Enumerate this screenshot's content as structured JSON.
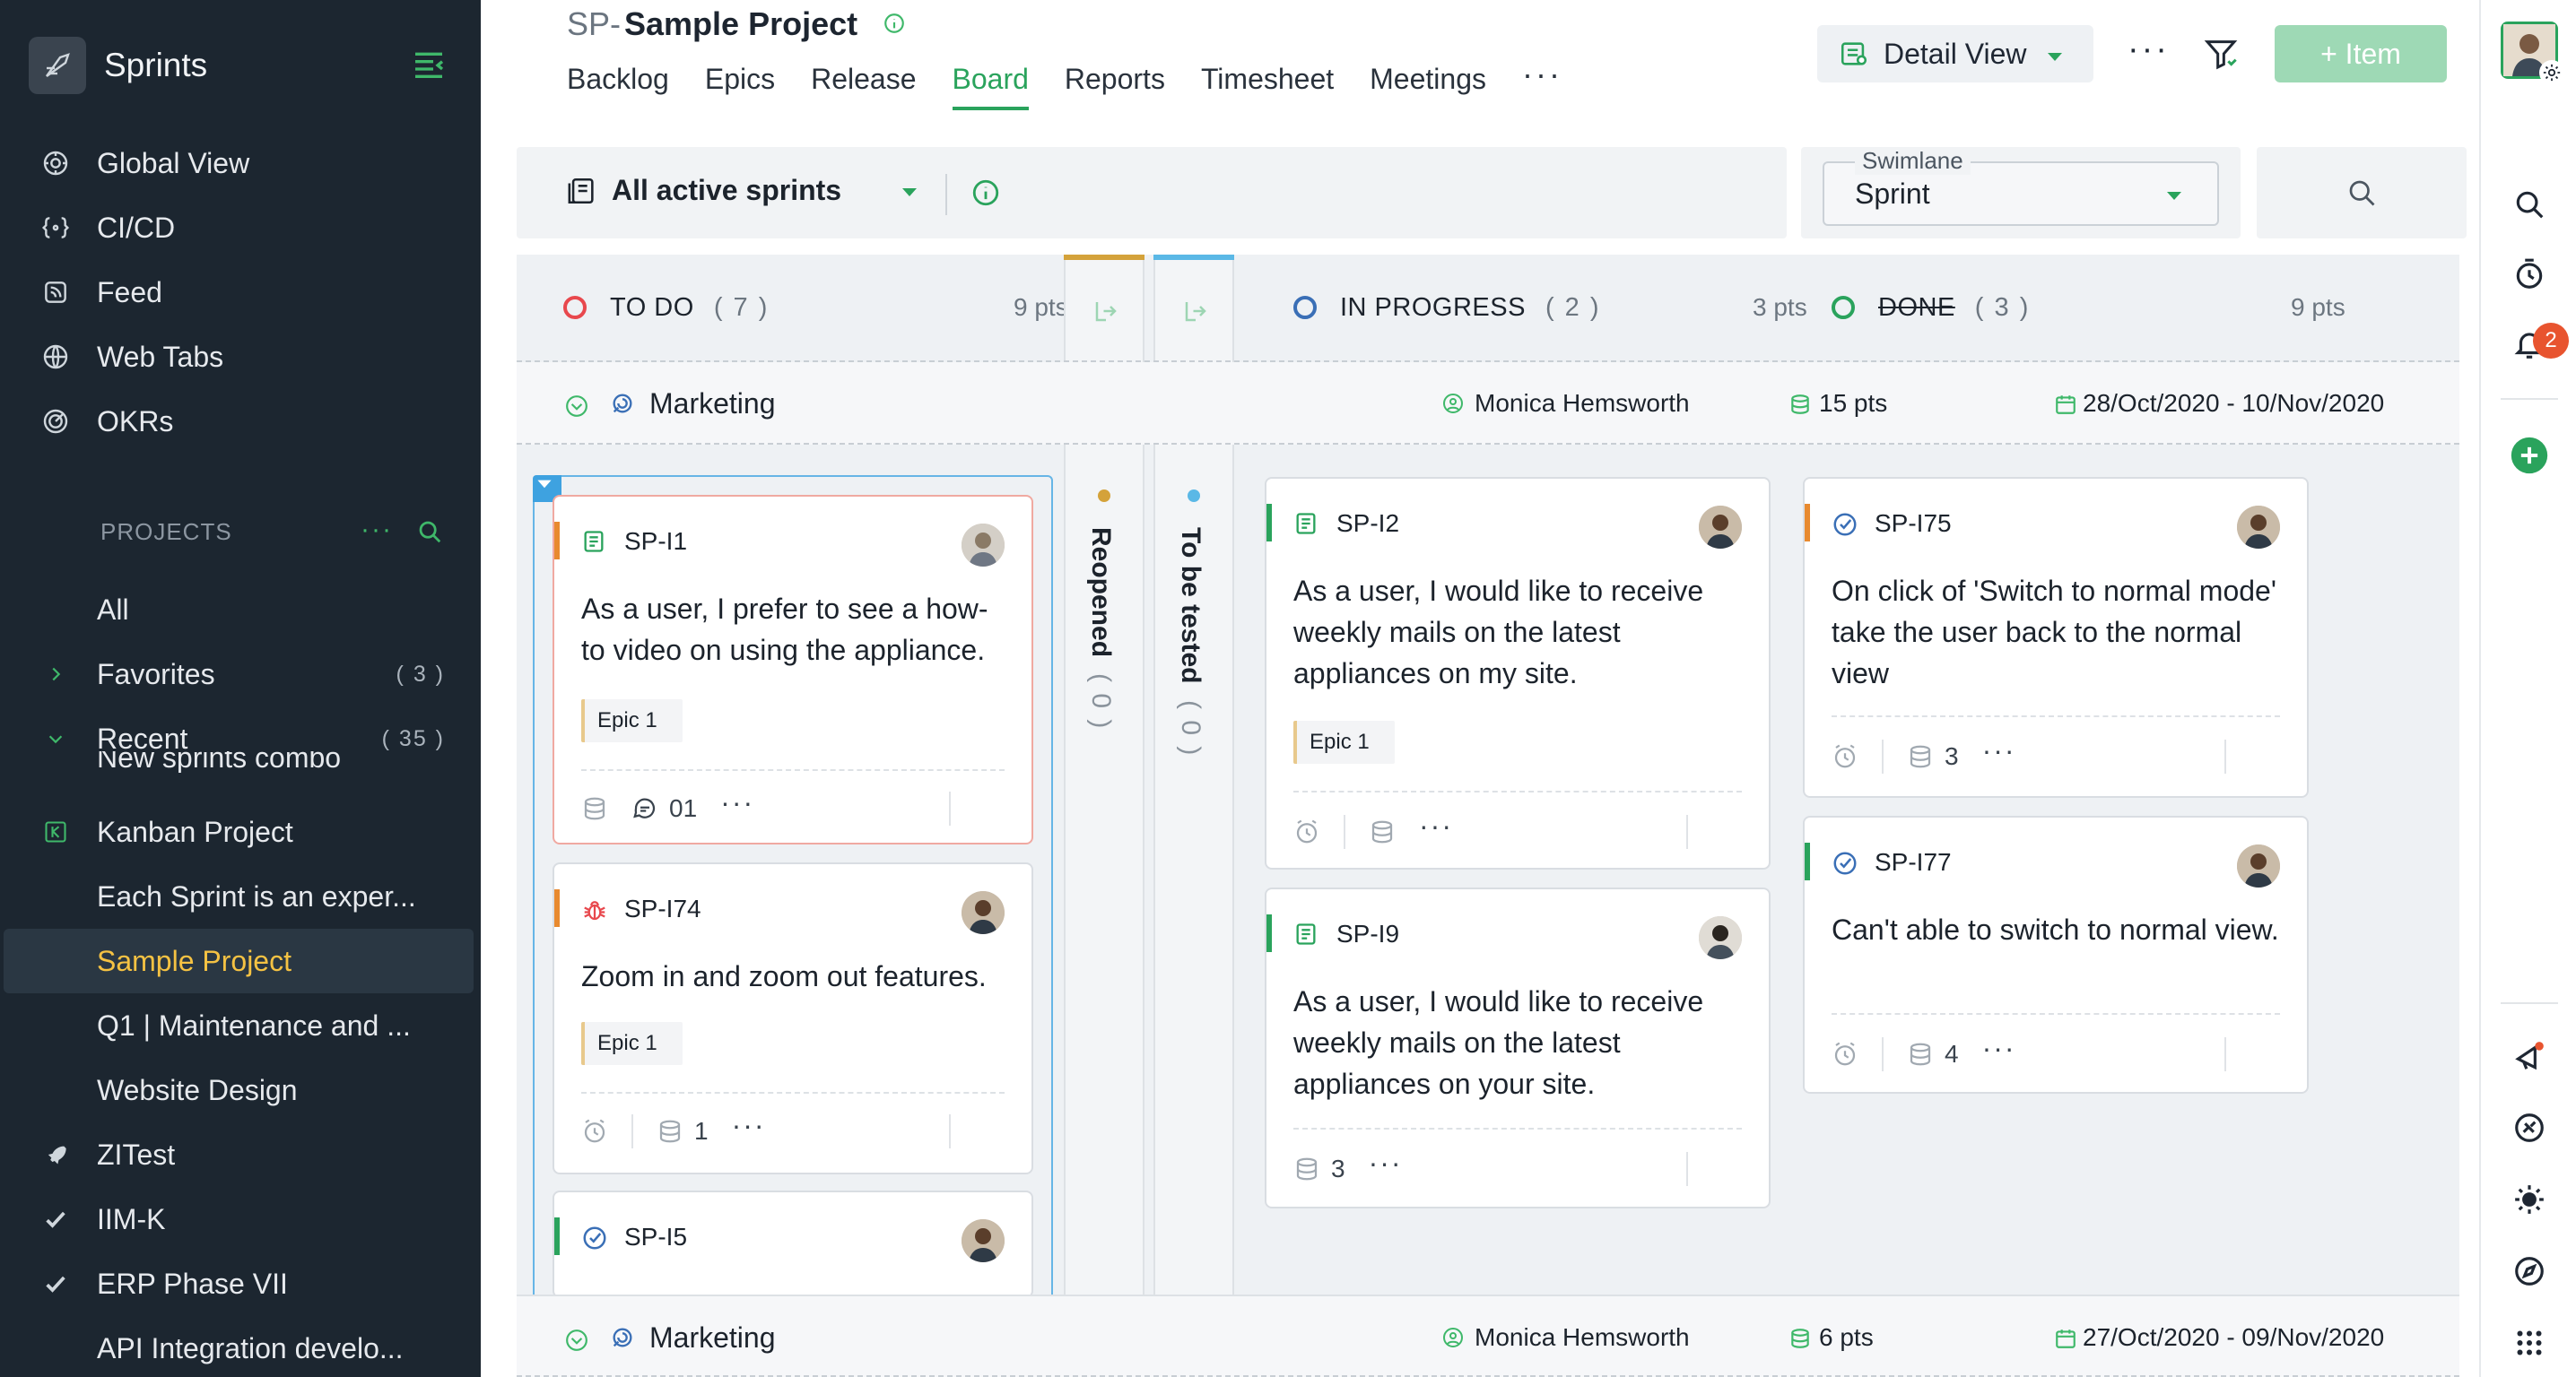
{
  "app": {
    "name": "Sprints",
    "accent": "#2aa35c"
  },
  "sidebar": {
    "nav": [
      {
        "label": "Global View",
        "icon": "global-view-icon"
      },
      {
        "label": "CI/CD",
        "icon": "cicd-icon"
      },
      {
        "label": "Feed",
        "icon": "feed-icon"
      },
      {
        "label": "Web Tabs",
        "icon": "web-tabs-icon"
      },
      {
        "label": "OKRs",
        "icon": "okrs-icon"
      }
    ],
    "projects_heading": "PROJECTS",
    "projects": [
      {
        "label": "All"
      },
      {
        "label": "Favorites",
        "count": "( 3 )"
      },
      {
        "label": "Recent",
        "count": "( 35 )"
      },
      {
        "label": "New sprints combo"
      },
      {
        "label": "Kanban Project"
      },
      {
        "label": "Each Sprint is an exper..."
      },
      {
        "label": "Sample Project"
      },
      {
        "label": "Q1 | Maintenance and ..."
      },
      {
        "label": "Website Design"
      },
      {
        "label": "ZITest"
      },
      {
        "label": "IIM-K"
      },
      {
        "label": "ERP Phase VII"
      },
      {
        "label": "API Integration develo..."
      }
    ]
  },
  "header": {
    "prefix": "SP-",
    "project_name": "Sample Project",
    "tabs": [
      "Backlog",
      "Epics",
      "Release",
      "Board",
      "Reports",
      "Timesheet",
      "Meetings"
    ],
    "active_tab": "Board",
    "view_label": "Detail View",
    "add_item_label": "+ Item"
  },
  "toolbar": {
    "sprint_filter": "All active sprints",
    "swimlane_legend": "Swimlane",
    "swimlane_value": "Sprint"
  },
  "rail": {
    "notification_count": "2"
  },
  "board": {
    "columns": [
      {
        "title": "TO DO",
        "count": "( 7 )",
        "pts": "9 pts",
        "color": "#e8484d"
      },
      {
        "title": "IN PROGRESS",
        "count": "( 2 )",
        "pts": "3 pts",
        "color": "#3a6fb6"
      },
      {
        "title": "DONE",
        "count": "( 3 )",
        "pts": "9 pts",
        "color": "#2aa35c"
      }
    ],
    "mini_columns": [
      {
        "label": "Reopened",
        "count": "( 0 )",
        "color": "#d4a23a"
      },
      {
        "label": "To be tested",
        "count": "( 0 )",
        "color": "#5ab8e6"
      }
    ],
    "swimlanes": [
      {
        "name": "Marketing",
        "owner": "Monica Hemsworth",
        "pts": "15 pts",
        "dates": "28/Oct/2020 - 10/Nov/2020"
      },
      {
        "name": "Marketing",
        "owner": "Monica Hemsworth",
        "pts": "6 pts",
        "dates": "27/Oct/2020 - 09/Nov/2020"
      }
    ],
    "cards": {
      "sp_i1": {
        "id": "SP-I1",
        "title": "As a user, I prefer to see a how-to video on using the appliance.",
        "epic": "Epic 1",
        "comments": "01"
      },
      "sp_i74": {
        "id": "SP-I74",
        "title": "Zoom in and zoom out features.",
        "epic": "Epic 1",
        "storypoints": "1"
      },
      "sp_i5": {
        "id": "SP-I5"
      },
      "sp_i2": {
        "id": "SP-I2",
        "title": "As a user, I would like to receive weekly mails on the latest appliances on my site.",
        "epic": "Epic 1"
      },
      "sp_i9": {
        "id": "SP-I9",
        "title": "As a user, I would like to receive weekly mails on the latest appliances on your site.",
        "storypoints": "3"
      },
      "sp_i75": {
        "id": "SP-I75",
        "title": "On click of 'Switch to normal mode' take the user back to the normal view",
        "storypoints": "3"
      },
      "sp_i77": {
        "id": "SP-I77",
        "title": "Can't able to switch to normal view.",
        "storypoints": "4"
      }
    }
  }
}
